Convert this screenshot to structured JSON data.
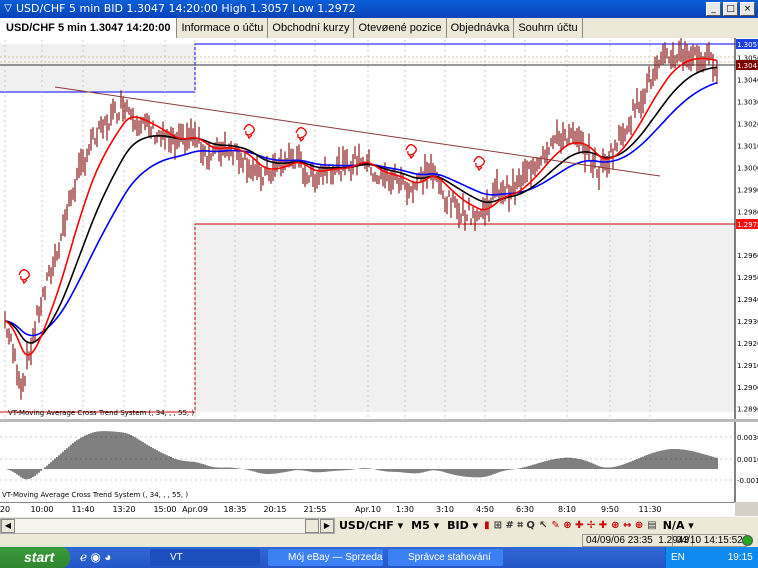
{
  "window": {
    "title": "USD/CHF 5 min BID 1.3047 14:20:00 High 1.3057 Low 1.2972",
    "app_icon": "vt-logo-icon",
    "controls": [
      "_",
      "□",
      "×"
    ]
  },
  "tabs": [
    {
      "label": "USD/CHF 5 min 1.3047 14:20:00",
      "active": true
    },
    {
      "label": "Informace o účtu"
    },
    {
      "label": "Obchodní kurzy"
    },
    {
      "label": "Otevøené pozice"
    },
    {
      "label": "Objednávka"
    },
    {
      "label": "Souhrn účtu"
    }
  ],
  "chart": {
    "indicator_label_main": "VT-Moving Average Cross Trend System (, 34, , , 55, )",
    "indicator_label_osc": "VT-Moving Average Cross Trend System (, 34, , , 55, )",
    "price_labels": [
      "1.3050",
      "1.3040",
      "1.3030",
      "1.3020",
      "1.3010",
      "1.3000",
      "1.2990",
      "1.2980",
      "1.2960",
      "1.2950",
      "1.2940",
      "1.2930",
      "1.2920",
      "1.2910",
      "1.2900",
      "1.2890"
    ],
    "markers": {
      "high": "1.3057",
      "bid": "1.3047",
      "low": "1.2972"
    },
    "osc_labels": [
      "0.0030",
      "0.0010",
      "-0.0010"
    ],
    "time_labels": [
      "20",
      "10:00",
      "11:40",
      "13:20",
      "15:00",
      "Apr.09",
      "18:35",
      "20:15",
      "21:55",
      "Apr.10",
      "1:30",
      "3:10",
      "4:50",
      "6:30",
      "8:10",
      "9:50",
      "11:30"
    ],
    "colors": {
      "candles": "#8b1a1a",
      "ma_fast": "#ff0000",
      "ma_mid": "#000000",
      "ma_slow": "#0000ff",
      "high_line": "#0000ff",
      "low_line": "#cc0000",
      "trendline": "#8b3a3a"
    }
  },
  "chart_data": {
    "type": "line",
    "ylim": [
      1.2885,
      1.3062
    ],
    "price_path": [
      1.293,
      1.29,
      1.2935,
      1.296,
      1.299,
      1.301,
      1.302,
      1.303,
      1.302,
      1.3015,
      1.301,
      1.3015,
      1.3005,
      1.301,
      1.3005,
      1.2995,
      1.3,
      1.3005,
      1.2995,
      1.3,
      1.3,
      1.3005,
      1.2995,
      1.2995,
      1.299,
      1.3,
      1.2985,
      1.298,
      1.2978,
      1.299,
      1.299,
      1.3,
      1.301,
      1.3015,
      1.301,
      1.2998,
      1.301,
      1.3025,
      1.304,
      1.305,
      1.3052,
      1.305,
      1.3047
    ]
  },
  "toolbar": {
    "symbol": "USD/CHF ▾",
    "timeframe": "M5 ▾",
    "price_type": "BID ▾",
    "na": "N/A ▾"
  },
  "status": {
    "cursor_time": "04/09/06 23:35",
    "cursor_price": "1.2943",
    "server_time": "04/10 14:15:52"
  },
  "taskbar": {
    "start": "start",
    "tasks": [
      "VT",
      "Mój eBay — Sprzeda...",
      "Správce stahování"
    ],
    "lang": "EN",
    "clock": "19:15"
  }
}
